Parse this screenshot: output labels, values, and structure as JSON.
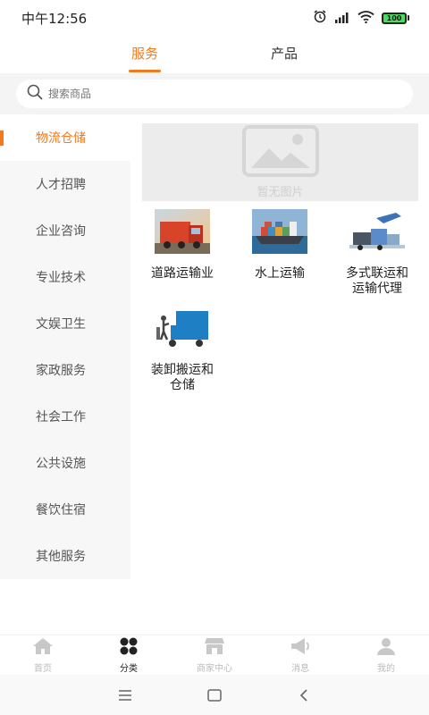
{
  "status_bar": {
    "time": "中午12:56",
    "battery": "100"
  },
  "tabs": [
    {
      "label": "服务"
    },
    {
      "label": "产品"
    }
  ],
  "search": {
    "placeholder": "搜索商品"
  },
  "sidebar": {
    "items": [
      {
        "label": "物流仓储"
      },
      {
        "label": "人才招聘"
      },
      {
        "label": "企业咨询"
      },
      {
        "label": "专业技术"
      },
      {
        "label": "文娱卫生"
      },
      {
        "label": "家政服务"
      },
      {
        "label": "社会工作"
      },
      {
        "label": "公共设施"
      },
      {
        "label": "餐饮住宿"
      },
      {
        "label": "其他服务"
      }
    ]
  },
  "banner": {
    "text": "暂无图片"
  },
  "categories": [
    {
      "line1": "道路运输业",
      "line2": ""
    },
    {
      "line1": "水上运输",
      "line2": ""
    },
    {
      "line1": "多式联运和",
      "line2": "运输代理"
    },
    {
      "line1": "装卸搬运和",
      "line2": "仓储"
    }
  ],
  "bottom_nav": [
    {
      "label": "首页"
    },
    {
      "label": "分类"
    },
    {
      "label": "商家中心"
    },
    {
      "label": "消息"
    },
    {
      "label": "我的"
    }
  ],
  "colors": {
    "accent": "#f47a1f",
    "sidebar_bg": "#f7f7f7",
    "inactive": "#bbbbbb"
  }
}
